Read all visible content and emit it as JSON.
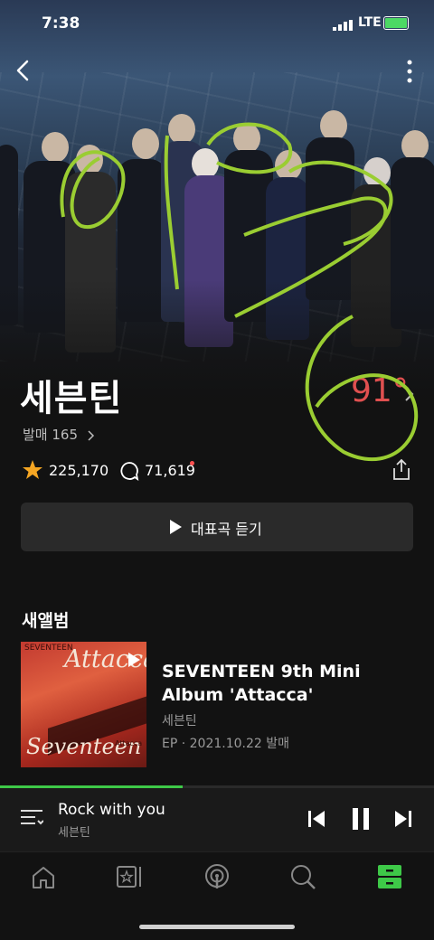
{
  "status_bar": {
    "time": "7:38",
    "network": "LTE"
  },
  "artist": {
    "name": "세븐틴",
    "temperature": "91°",
    "release_label": "발매 165",
    "fans": "225,170",
    "comments": "71,619"
  },
  "actions": {
    "play_representative": "대표곡 듣기"
  },
  "new_album": {
    "section_title": "새앨범",
    "cover_text_top": "SEVENTEEN",
    "cover_text_title": "Attacca",
    "cover_text_bottom": "Seventeen",
    "cover_text_small": "Attacca",
    "title": "SEVENTEEN 9th Mini Album 'Attacca'",
    "artist": "세븐틴",
    "meta": "EP · 2021.10.22 발매"
  },
  "mini_player": {
    "song": "Rock with you",
    "artist": "세븐틴",
    "progress": 0.42
  },
  "tabs": [
    "home-icon",
    "library-icon",
    "podcast-icon",
    "search-icon",
    "storage-icon"
  ],
  "colors": {
    "accent": "#3ec948",
    "temperature": "#e05050",
    "star": "#f5a623"
  }
}
